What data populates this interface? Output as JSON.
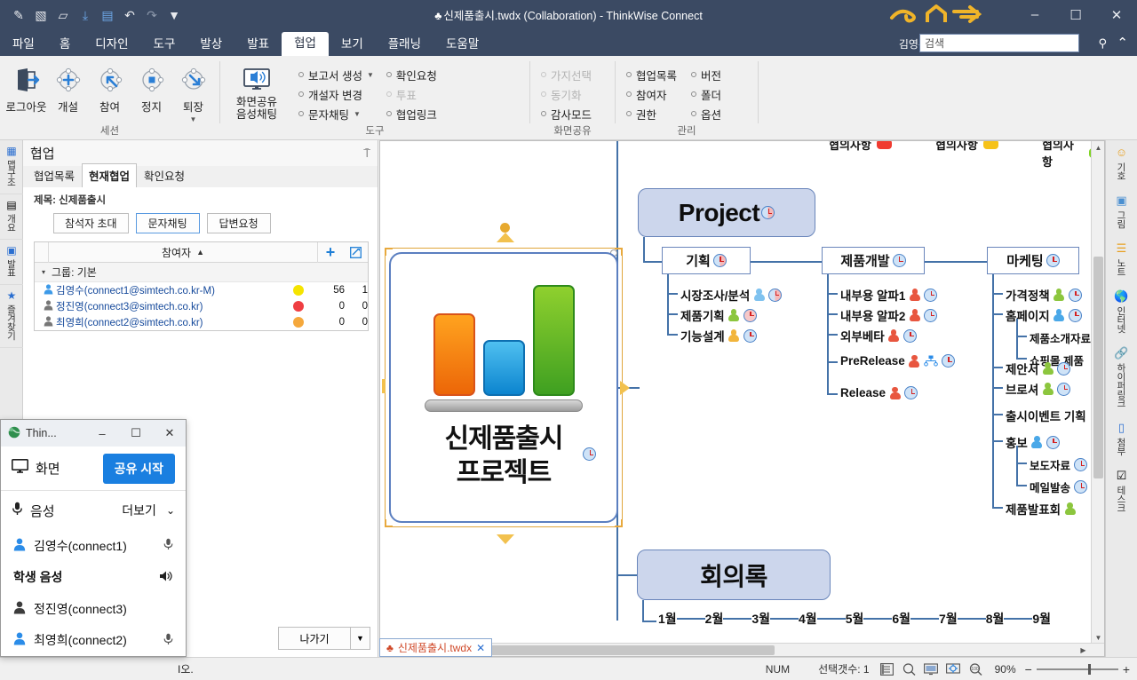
{
  "window": {
    "title": "신제품출시.twdx (Collaboration) - ThinkWise Connect",
    "spade": "♣",
    "minimize": "–",
    "maximize": "☐",
    "close": "✕"
  },
  "quick_access": [
    {
      "name": "pen-icon",
      "glyph": "✎"
    },
    {
      "name": "new-doc-icon",
      "glyph": "▧"
    },
    {
      "name": "open-folder-icon",
      "glyph": "▱"
    },
    {
      "name": "save-icon",
      "glyph": "⤓"
    },
    {
      "name": "present-icon",
      "glyph": "▤"
    },
    {
      "name": "undo-icon",
      "glyph": "↶"
    },
    {
      "name": "redo-icon",
      "glyph": "↷"
    },
    {
      "name": "customize-icon",
      "glyph": "▼"
    }
  ],
  "menubar": {
    "items": [
      {
        "label": "파일",
        "active": false
      },
      {
        "label": "홈",
        "active": false
      },
      {
        "label": "디자인",
        "active": false
      },
      {
        "label": "도구",
        "active": false
      },
      {
        "label": "발상",
        "active": false
      },
      {
        "label": "발표",
        "active": false
      },
      {
        "label": "협업",
        "active": true
      },
      {
        "label": "보기",
        "active": false
      },
      {
        "label": "플래닝",
        "active": false
      },
      {
        "label": "도움말",
        "active": false
      }
    ],
    "user": "김영수",
    "search_value": "검색",
    "search_icon": "⚲",
    "collapse_icon": "⌃"
  },
  "ribbon": {
    "groups": [
      {
        "label": "세션",
        "big_buttons": [
          {
            "label": "로그아웃",
            "icon": "logout-icon"
          },
          {
            "label": "개설",
            "icon": "create-session-icon"
          },
          {
            "label": "참여",
            "icon": "join-session-icon"
          },
          {
            "label": "정지",
            "icon": "stop-session-icon"
          },
          {
            "label": "퇴장",
            "icon": "leave-session-icon",
            "caret": true
          }
        ]
      },
      {
        "label": "도구",
        "screen_share_button": {
          "line1": "화면공유",
          "line2": "음성채팅",
          "icon": "screen-share-icon"
        },
        "small_buttons": [
          {
            "label": "보고서 생성",
            "caret": true,
            "disabled": false
          },
          {
            "label": "개설자 변경",
            "caret": false,
            "disabled": false
          },
          {
            "label": "문자채팅",
            "caret": true,
            "disabled": false
          },
          {
            "label": "확인요청",
            "caret": false,
            "disabled": false
          },
          {
            "label": "투표",
            "caret": false,
            "disabled": true
          },
          {
            "label": "협업링크",
            "caret": false,
            "disabled": false
          }
        ]
      },
      {
        "label": "화면공유",
        "small_buttons": [
          {
            "label": "가지선택",
            "caret": false,
            "disabled": true
          },
          {
            "label": "동기화",
            "caret": false,
            "disabled": true
          },
          {
            "label": "감사모드",
            "caret": false,
            "disabled": false
          }
        ]
      },
      {
        "label": "관리",
        "small_buttons": [
          {
            "label": "협업목록",
            "caret": false,
            "disabled": false
          },
          {
            "label": "참여자",
            "caret": false,
            "disabled": false
          },
          {
            "label": "권한",
            "caret": false,
            "disabled": false
          },
          {
            "label": "버전",
            "caret": false,
            "disabled": false
          },
          {
            "label": "폴더",
            "caret": false,
            "disabled": false
          },
          {
            "label": "옵션",
            "caret": false,
            "disabled": false
          }
        ]
      }
    ]
  },
  "left_strip": {
    "tabs": [
      {
        "label": "맵구조",
        "icon": "map-structure-icon",
        "glyph": "▦",
        "color": "#2b6fd0"
      },
      {
        "label": "개요",
        "icon": "outline-icon",
        "glyph": "▤",
        "color": "#444"
      },
      {
        "label": "발표",
        "icon": "presentation-icon",
        "glyph": "▣",
        "color": "#2b6fd0"
      },
      {
        "label": "즐겨찾기",
        "icon": "favorites-icon",
        "glyph": "★",
        "color": "#2b6fd0"
      }
    ]
  },
  "collab_panel": {
    "title": "협업",
    "pin_icon": "⍑",
    "tabs": [
      {
        "label": "협업목록",
        "active": false
      },
      {
        "label": "현재협업",
        "active": true
      },
      {
        "label": "확인요청",
        "active": false
      }
    ],
    "subject": "제목: 신제품출시",
    "buttons": [
      {
        "label": "참석자 초대",
        "focus": false
      },
      {
        "label": "문자채팅",
        "focus": true
      },
      {
        "label": "답변요청",
        "focus": false
      }
    ],
    "grid": {
      "header": "참여자",
      "sort_arrow": "▲",
      "add_icon": "+",
      "edit_icon": "✎",
      "group_label": "그룹: 기본",
      "rows": [
        {
          "name": "김영수(connect1@simtech.co.kr-M)",
          "status_color": "#f5e400",
          "col1": "56",
          "col2": "1",
          "avatar_color": "#3d9ae8"
        },
        {
          "name": "정진영(connect3@simtech.co.kr)",
          "status_color": "#ef3e42",
          "col1": "0",
          "col2": "0",
          "avatar_color": "#777777"
        },
        {
          "name": "최영희(connect2@simtech.co.kr)",
          "status_color": "#f5a83c",
          "col1": "0",
          "col2": "0",
          "avatar_color": "#777777"
        }
      ]
    },
    "exit_button": "나가기",
    "exit_caret": "▼"
  },
  "share_dialog": {
    "app_icon": "🌐",
    "title": "Thin...",
    "minimize": "–",
    "maximize": "☐",
    "close": "✕",
    "screen_label": "화면",
    "screen_icon": "⎕",
    "share_button": "공유 시작",
    "voice_label": "음성",
    "mic_icon": "🎤",
    "more_label": "더보기",
    "more_caret": "⌄",
    "users": [
      {
        "name": "김영수(connect1)",
        "bold": false,
        "avatar_color": "#2b8ce8",
        "trailing_icon": "mic-icon",
        "trailing_glyph": "🎤"
      },
      {
        "name": "학생 음성",
        "bold": true,
        "avatar_color": "",
        "trailing_icon": "speaker-icon",
        "trailing_glyph": "🔊"
      },
      {
        "name": "정진영(connect3)",
        "bold": false,
        "avatar_color": "#3c3c3c",
        "trailing_icon": "",
        "trailing_glyph": ""
      },
      {
        "name": "최영희(connect2)",
        "bold": false,
        "avatar_color": "#2b8ce8",
        "trailing_icon": "mic-icon",
        "trailing_glyph": "🎤"
      }
    ]
  },
  "mindmap": {
    "central_node": {
      "line1": "신제품출시",
      "line2": "프로젝트",
      "icon": "bar-chart-icon"
    },
    "project_node": "Project",
    "minutes_node": "회의록",
    "branches": [
      {
        "title": "기획",
        "clock": "half",
        "children": [
          {
            "label": "시장조사/분석",
            "person": "#7fc2ef",
            "clock": "half"
          },
          {
            "label": "제품기획",
            "person": "#8cc63e",
            "clock": "r"
          },
          {
            "label": "기능설계",
            "person": "#f2b53c",
            "clock": "normal"
          }
        ]
      },
      {
        "title": "제품개발",
        "clock": "normal",
        "children": [
          {
            "label": "내부용 알파1",
            "person": "#e8563f",
            "clock": "normal"
          },
          {
            "label": "내부용 알파2",
            "person": "#e8563f",
            "clock": "normal"
          },
          {
            "label": "외부베타",
            "person": "#e8563f",
            "clock": "normal"
          },
          {
            "label": "PreRelease",
            "person": "#e8563f",
            "clock": "normal",
            "extra_icon": "network-icon"
          },
          {
            "label": "Release",
            "person": "#e8563f",
            "clock": "normal"
          }
        ]
      },
      {
        "title": "마케팅",
        "clock": "normal",
        "children": [
          {
            "label": "가격정책",
            "person": "#8cc63e",
            "clock": "normal"
          },
          {
            "label": "홈페이지",
            "person": "#4aa8e8",
            "clock": "normal",
            "subs": [
              {
                "label": "제품소개자료"
              },
              {
                "label": "쇼핑몰 제품"
              }
            ]
          },
          {
            "label": "제안서",
            "person": "#8cc63e",
            "clock": "normal"
          },
          {
            "label": "브로셔",
            "person": "#8cc63e",
            "clock": "normal"
          },
          {
            "label": "출시이벤트 기획"
          },
          {
            "label": "홍보",
            "person": "#4aa8e8",
            "clock": "normal",
            "subs": [
              {
                "label": "보도자료"
              },
              {
                "label": "메일발송"
              }
            ]
          },
          {
            "label": "제품발표회",
            "person": "#8cc63e"
          }
        ]
      }
    ],
    "cut_nodes": [
      {
        "label": "협의사항",
        "color": "#f03b30"
      },
      {
        "label": "협의사항",
        "color": "#f6c21a"
      },
      {
        "label": "협의사항",
        "color": "#7ed321"
      }
    ],
    "timeline_months": [
      "1월",
      "2월",
      "3월",
      "4월",
      "5월",
      "6월",
      "7월",
      "8월",
      "9월"
    ]
  },
  "right_strip": {
    "tabs": [
      {
        "label": "기호",
        "icon": "emoji-icon",
        "glyph": "☺",
        "color": "#e8a020"
      },
      {
        "label": "그림",
        "icon": "picture-icon",
        "glyph": "▣",
        "color": "#4a8fd0"
      },
      {
        "label": "노트",
        "icon": "note-icon",
        "glyph": "≡",
        "color": "#e8a020"
      },
      {
        "label": "인터넷",
        "icon": "internet-icon",
        "glyph": "⊕",
        "color": "#2b6fd0"
      },
      {
        "label": "하이퍼링크",
        "icon": "hyperlink-icon",
        "glyph": "⚭",
        "color": "#2b6fd0"
      },
      {
        "label": "첨부",
        "icon": "attachment-icon",
        "glyph": "▭",
        "color": "#2b6fd0"
      },
      {
        "label": "테스크",
        "icon": "task-icon",
        "glyph": "☑",
        "color": "#444"
      }
    ]
  },
  "doc_tab": {
    "spade": "♣",
    "label": "신제품출시.twdx",
    "close": "✕"
  },
  "statusbar": {
    "hint": "I오.",
    "num_lock": "NUM",
    "selection": "선택갯수: 1",
    "view_icons": [
      {
        "name": "outline-view-icon",
        "glyph": "▤"
      },
      {
        "name": "zoom-out-view-icon",
        "glyph": "⚲"
      },
      {
        "name": "presentation-view-icon",
        "glyph": "▣"
      },
      {
        "name": "fit-view-icon",
        "glyph": "⌘"
      },
      {
        "name": "zoom-100-icon",
        "glyph": "◎"
      }
    ],
    "zoom_level": "90%",
    "zoom_minus": "−",
    "zoom_plus": "+"
  }
}
